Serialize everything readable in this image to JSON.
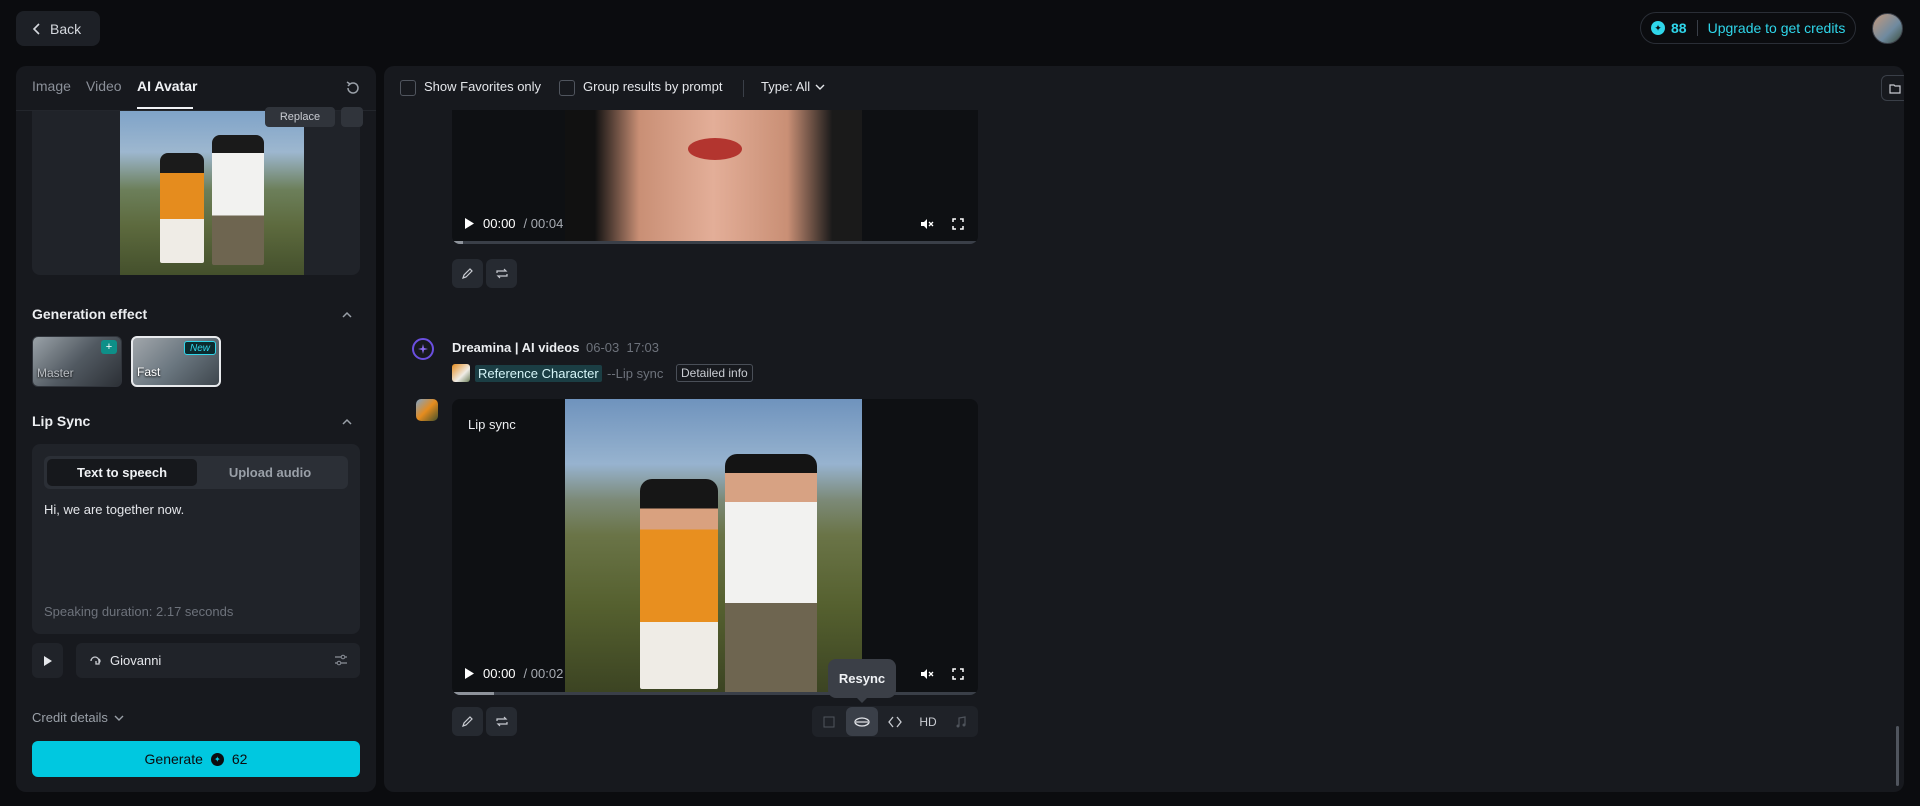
{
  "topbar": {
    "back_label": "Back",
    "credits_count": "88",
    "credits_upgrade": "Upgrade to get credits"
  },
  "left": {
    "tabs": [
      {
        "label": "Image"
      },
      {
        "label": "Video"
      },
      {
        "label": "AI Avatar"
      }
    ],
    "active_tab": "AI Avatar",
    "reference": {
      "replace_label": "Replace"
    },
    "generation_effect": {
      "title": "Generation effect",
      "options": [
        {
          "label": "Master",
          "badge": "+"
        },
        {
          "label": "Fast",
          "badge": "New",
          "selected": true
        }
      ]
    },
    "lip_sync": {
      "title": "Lip Sync",
      "modes": [
        "Text to speech",
        "Upload audio"
      ],
      "active_mode": "Text to speech",
      "text": "Hi, we are together now.",
      "duration": "Speaking duration: 2.17 seconds"
    },
    "voice": {
      "name": "Giovanni"
    },
    "credit_details": "Credit details",
    "generate": {
      "label": "Generate",
      "cost": "62"
    }
  },
  "right": {
    "filters": {
      "favorites": "Show Favorites only",
      "group": "Group results by prompt",
      "type": "Type: All"
    },
    "video_top": {
      "current": "00:00",
      "total": "/ 00:04",
      "progress": 0.02
    },
    "generation": {
      "author": "Dreamina | AI videos",
      "date": "06-03",
      "time": "17:03",
      "reference": "Reference Character",
      "mode": "--Lip sync",
      "detailed_info": "Detailed info"
    },
    "video_main": {
      "badge": "Lip sync",
      "current": "00:00",
      "total": "/ 00:02",
      "progress": 0.08
    },
    "tools": {
      "hd": "HD",
      "tooltip": "Resync"
    }
  },
  "colors": {
    "accent": "#00c8e0",
    "panel": "#17191e",
    "background": "#0b0c0f"
  }
}
